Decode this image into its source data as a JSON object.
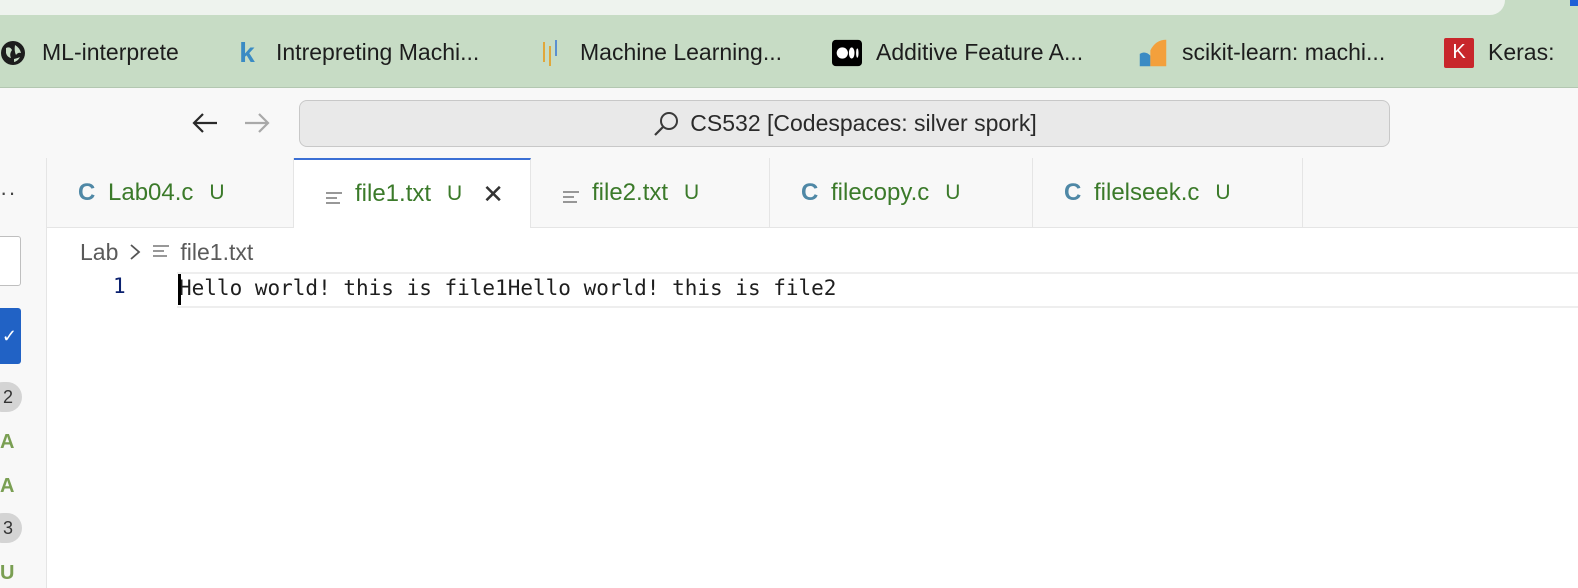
{
  "bookmarks": [
    {
      "label": "ML-interprete",
      "icon": "globe-icon"
    },
    {
      "label": "Intrepreting Machi...",
      "icon": "kaggle-k-icon"
    },
    {
      "label": "Machine Learning...",
      "icon": "bars-logo-icon"
    },
    {
      "label": "Additive Feature A...",
      "icon": "medium-logo-icon"
    },
    {
      "label": "scikit-learn: machi...",
      "icon": "sklearn-logo-icon"
    },
    {
      "label": "Keras:",
      "icon": "keras-k-icon"
    }
  ],
  "titlebar": {
    "search_text": "CS532 [Codespaces: silver spork]",
    "back_icon": "arrow-left-icon",
    "forward_icon": "arrow-right-icon",
    "search_icon": "search-icon"
  },
  "sidebar_fragment": {
    "badges": [
      "2",
      "3"
    ],
    "letters": [
      "A",
      "A",
      "U"
    ]
  },
  "tabs": [
    {
      "icon": "C",
      "label": "Lab04.c",
      "status": "U",
      "active": false
    },
    {
      "icon": "text-file-icon",
      "label": "file1.txt",
      "status": "U",
      "active": true
    },
    {
      "icon": "text-file-icon",
      "label": "file2.txt",
      "status": "U",
      "active": false
    },
    {
      "icon": "C",
      "label": "filecopy.c",
      "status": "U",
      "active": false
    },
    {
      "icon": "C",
      "label": "filelseek.c",
      "status": "U",
      "active": false
    }
  ],
  "breadcrumb": {
    "folder": "Lab",
    "file": "file1.txt"
  },
  "editor": {
    "line_number": "1",
    "line_text": "Hello world! this is file1Hello world! this is file2"
  },
  "colors": {
    "bookmark_bar": "#c7dcc5",
    "tab_accent": "#3b6fd4",
    "modified_green": "#3b7a2a",
    "c_icon": "#4f88a6",
    "line_number": "#0b216f"
  }
}
